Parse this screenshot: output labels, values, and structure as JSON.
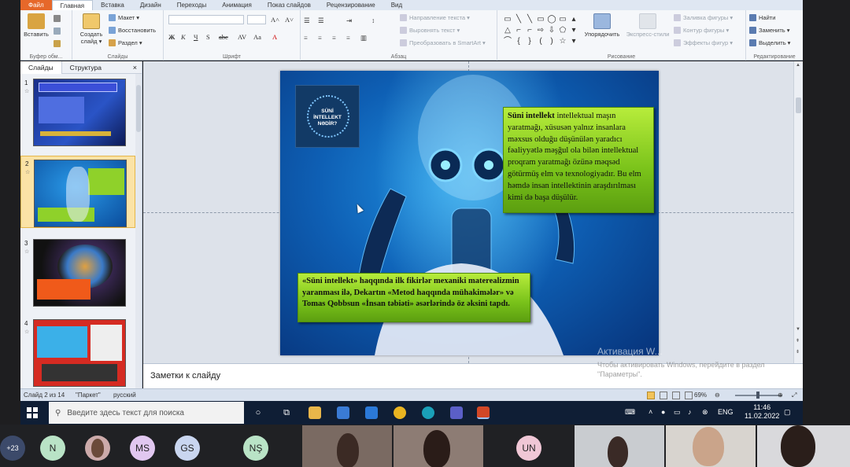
{
  "tabs": [
    "Файл",
    "Главная",
    "Вставка",
    "Дизайн",
    "Переходы",
    "Анимация",
    "Показ слайдов",
    "Рецензирование",
    "Вид"
  ],
  "ribbon": {
    "paste": "Вставить",
    "clipboard_label": "Буфер обм...",
    "create_slide": "Создать слайд ▾",
    "layout": "Макет ▾",
    "restore": "Восстановить",
    "section": "Раздел ▾",
    "slides_label": "Слайды",
    "font_label": "Шрифт",
    "paragraph_label": "Абзац",
    "text_direction": "Направление текста ▾",
    "align_text": "Выровнять текст ▾",
    "smartart": "Преобразовать в SmartArt ▾",
    "arrange": "Упорядочить",
    "quick_styles": "Экспресс-стили",
    "drawing_label": "Рисование",
    "shape_fill": "Заливка фигуры ▾",
    "shape_outline": "Контур фигуры ▾",
    "shape_effects": "Эффекты фигур ▾",
    "find": "Найти",
    "replace": "Заменить ▾",
    "select": "Выделить ▾",
    "editing_label": "Редактирование"
  },
  "panel": {
    "tab_slides": "Слайды",
    "tab_outline": "Структура",
    "close": "×",
    "thumbs": [
      {
        "num": "1",
        "selected": false
      },
      {
        "num": "2",
        "selected": true
      },
      {
        "num": "3",
        "selected": false
      },
      {
        "num": "4",
        "selected": false
      }
    ]
  },
  "slide": {
    "logo_text": "SÜNİ\nİNTELLEKT\nNƏDİR?",
    "box1_bold": "Süni intellekt",
    "box1_text": " intellektual maşın yaratmağı, xüsusən yalnız insanlara məxsus olduğu düşünülən yaradıcı fəaliyyətlə məşğul ola bilən intellektual proqram yaratmağı özünə məqsəd götürmüş elm və texnologiyadır. Bu elm həmdə insan intellektinin araşdırılması kimi də başa düşülür.",
    "box2_text": "«Süni intellekt» haqqında ilk fikirlər mexaniki materealizmin yaranması ilə, Dekartın «Metod haqqında mühakimələr» və Tomas Qobbsun «İnsan təbiəti» əsərlərində öz əksini tapdı."
  },
  "notes": {
    "placeholder": "Заметки к слайду"
  },
  "watermark": {
    "title": "Активация W...",
    "sub": "Чтобы активировать Windows, перейдите в раздел \"Параметры\"."
  },
  "status": {
    "slide": "Слайд 2 из 14",
    "theme": "\"Паркет\"",
    "lang": "русский",
    "zoom": "69%",
    "zoom_fraction": 0.69
  },
  "taskbar": {
    "search_placeholder": "Введите здесь текст для поиска",
    "lang": "ENG",
    "time": "11:46",
    "date": "11.02.2022"
  },
  "meeting": {
    "more_count": "+23",
    "participants": [
      "N",
      "MS",
      "GS",
      "NŞ",
      "UN"
    ]
  },
  "colors": {
    "accent": "#e6682a",
    "green_box": "#8fd12a",
    "slide_bg": "#0e5fb4",
    "taskbar": "#0f1e35"
  }
}
